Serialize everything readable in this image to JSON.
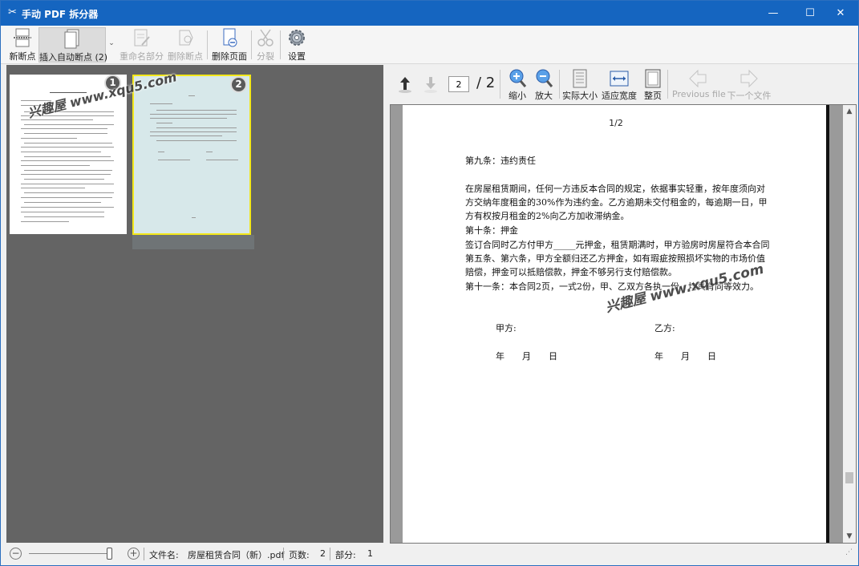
{
  "window": {
    "title": "手动 PDF 拆分器",
    "minimize": "—",
    "maximize": "☐",
    "close": "✕"
  },
  "toolbar": {
    "new_breakpoint": "新断点",
    "insert_auto_breakpoint": "插入自动断点 (2)",
    "rename_part": "重命名部分",
    "delete_breakpoint": "删除断点",
    "delete_page": "删除页面",
    "split": "分裂",
    "settings": "设置"
  },
  "thumbnails": [
    {
      "number": "1"
    },
    {
      "number": "2"
    }
  ],
  "watermark": "兴趣屋 www.xqu5.com",
  "viewer": {
    "current_page": "2",
    "total_pages": "/ 2",
    "zoom_out": "缩小",
    "zoom_in": "放大",
    "actual_size": "实际大小",
    "fit_width": "适应宽度",
    "whole_page": "整页",
    "previous_file": "Previous file",
    "next_file": "下一个文件"
  },
  "document": {
    "page_label": "1/2",
    "heading9": "第九条：违约责任",
    "para9": "在房屋租赁期间，任何一方违反本合同的规定，依据事实轻重，按年度须向对方交纳年度租金的30%作为违约金。乙方逾期未交付租金的，每逾期一日，甲方有权按月租金的2%向乙方加收滞纳金。",
    "heading10": "第十条：押金",
    "para10": "签订合同时乙方付甲方_____元押金，租赁期满时，甲方验房时房屋符合本合同第五条、第六条，甲方全额归还乙方押金，如有瑕疵按照损坏实物的市场价值赔偿，押金可以抵赔偿款，押金不够另行支付赔偿款。",
    "para11": "第十一条：本合同2页，一式2份，甲、乙双方各执一份，均具有同等效力。",
    "party_a": "甲方:",
    "party_b": "乙方:",
    "date_a": "年　　月　　日",
    "date_b": "年　　月　　日"
  },
  "status": {
    "filename_label": "文件名:",
    "filename": "房屋租赁合同（新）.pdf",
    "pages_label": "页数:",
    "pages": "2",
    "parts_label": "部分:",
    "parts": "1"
  },
  "icons": {
    "app": "scissors-icon",
    "up": "arrow-up-icon",
    "down": "arrow-down-icon"
  }
}
